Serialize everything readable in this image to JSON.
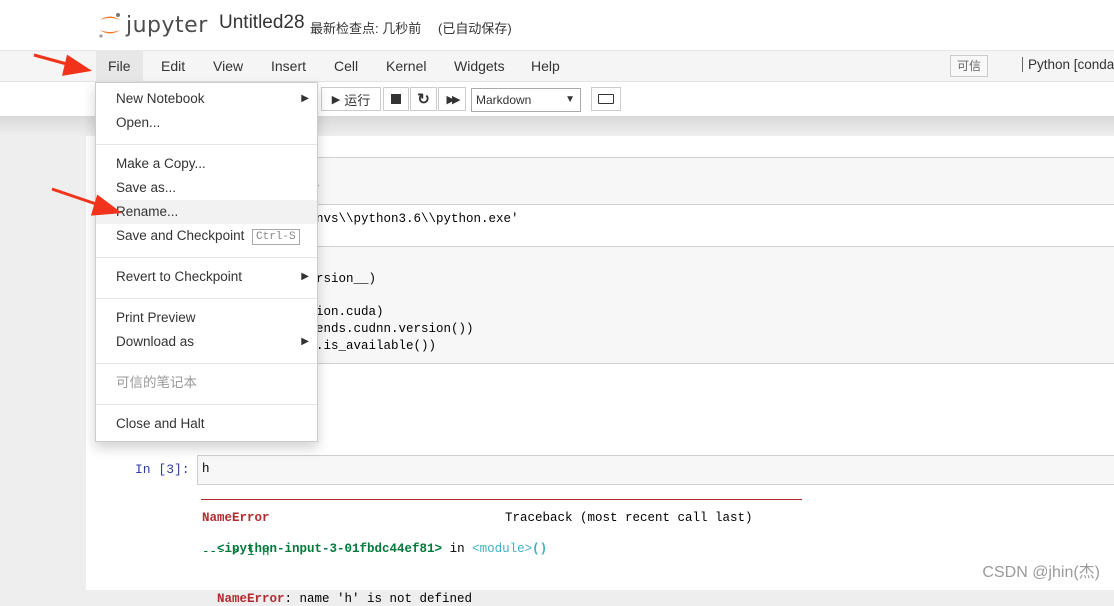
{
  "header": {
    "logo_text": "jupyter",
    "notebook_name": "Untitled28",
    "checkpoint_text": "最新检查点: 几秒前",
    "autosave_text": "(已自动保存)"
  },
  "menubar": {
    "items": [
      "File",
      "Edit",
      "View",
      "Insert",
      "Cell",
      "Kernel",
      "Widgets",
      "Help"
    ],
    "trusted_label": "可信",
    "kernel_name": "Python [conda"
  },
  "toolbar": {
    "run_label": "运行",
    "cell_type": "Markdown"
  },
  "file_menu": {
    "new_notebook": "New Notebook",
    "open": "Open...",
    "make_copy": "Make a Copy...",
    "save_as": "Save as...",
    "rename": "Rename...",
    "save_checkpoint": "Save and Checkpoint",
    "save_checkpoint_shortcut": "Ctrl-S",
    "revert_checkpoint": "Revert to Checkpoint",
    "print_preview": "Print Preview",
    "download_as": "Download as",
    "trusted_notebook": "可信的笔记本",
    "close_halt": "Close and Halt"
  },
  "notebook": {
    "code_fragment_1": "r",
    "output_fragment_1": "nvs\\\\python3.6\\\\python.exe'",
    "code_fragment_2": "rsion__)",
    "code_fragment_3": "ion.cuda)",
    "code_fragment_4": "ends.cudnn.version())",
    "code_fragment_5": ".is_available())",
    "cell3_prompt": "In  [3]:",
    "cell3_code": "h",
    "error_name": "NameError",
    "traceback_label": "Traceback (most recent call last)",
    "error_location": "<ipython-input-3-01fbdc44ef81>",
    "error_in": " in ",
    "error_module": "<module>",
    "error_parens": "()",
    "error_arrow_line": "----> 1 h",
    "error_message_name": "NameError",
    "error_message_text": ": name 'h' is not defined"
  },
  "watermark": "CSDN @jhin(杰)",
  "colors": {
    "annotation_arrow": "#f0331a",
    "error_red": "#b22b31",
    "module_cyan": "#3fb2c0",
    "location_green": "#00793b"
  },
  "icons": [
    "jupyter-logo-icon",
    "run-icon",
    "stop-icon",
    "restart-icon",
    "fast-forward-icon",
    "keyboard-icon",
    "submenu-arrow-icon"
  ]
}
